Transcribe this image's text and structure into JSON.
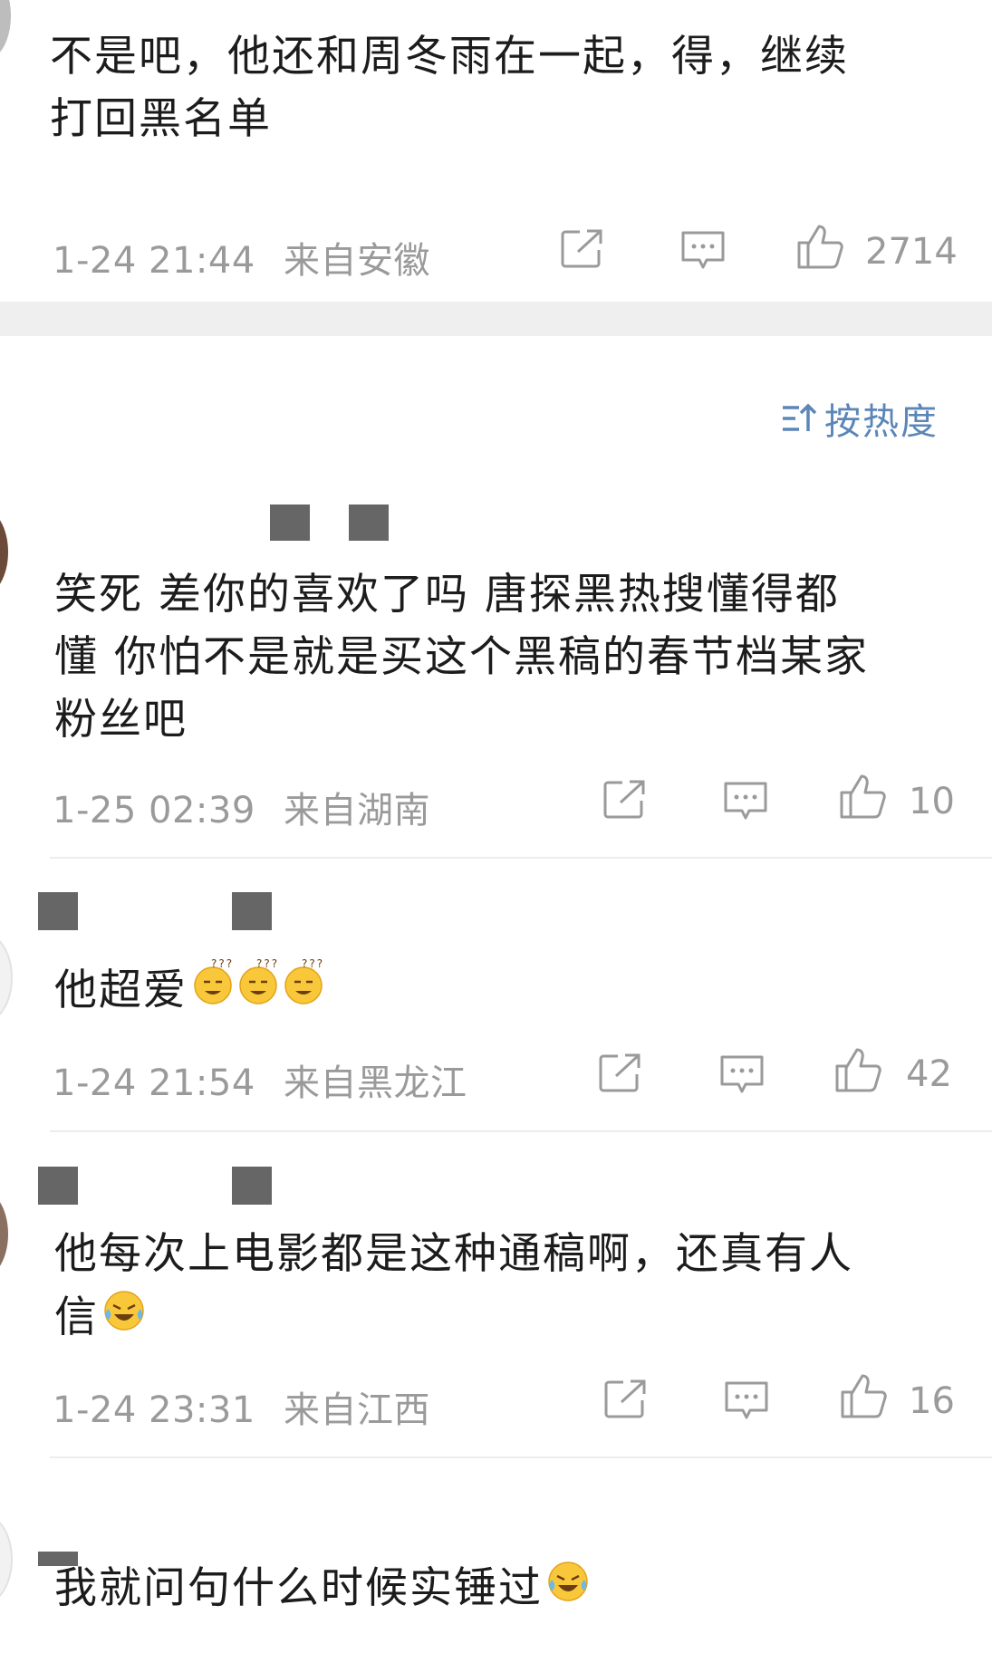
{
  "sort": {
    "label": "按热度"
  },
  "comments": [
    {
      "lines": [
        "不是吧，他还和周冬雨在一起，得，继续",
        "打回黑名单"
      ],
      "time": "1-24 21:44",
      "location": "来自安徽",
      "likes": "2714"
    },
    {
      "lines": [
        "笑死  差你的喜欢了吗  唐探黑热搜懂得都",
        "懂  你怕不是就是买这个黑稿的春节档某家",
        "粉丝吧"
      ],
      "time": "1-25 02:39",
      "location": "来自湖南",
      "likes": "10"
    },
    {
      "lines": [
        "他超爱"
      ],
      "time": "1-24 21:54",
      "location": "来自黑龙江",
      "likes": "42"
    },
    {
      "lines": [
        "他每次上电影都是这种通稿啊，还真有人",
        "信"
      ],
      "time": "1-24 23:31",
      "location": "来自江西",
      "likes": "16"
    },
    {
      "lines": [
        "我就问句什么时候实锤过"
      ]
    }
  ],
  "icons": {
    "share": "share-icon",
    "reply": "comment-icon",
    "like": "thumbs-up-icon",
    "sort": "sort-icon"
  },
  "colors": {
    "sort_blue": "#5b86b8",
    "meta_gray": "#9a9a9a",
    "text": "#1c1c1c"
  }
}
